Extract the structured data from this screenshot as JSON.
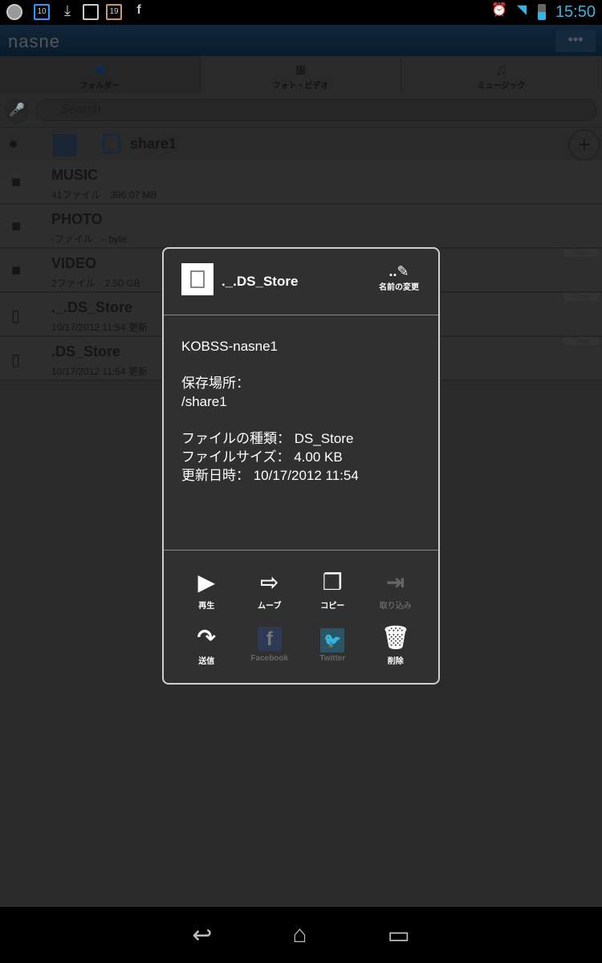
{
  "status_bar": {
    "time": "15:50",
    "notifications": [
      "nasne-icon",
      "calendar-10-icon",
      "download-icon",
      "image-icon",
      "calendar-19-icon",
      "facebook-icon"
    ],
    "calendar_a": "10",
    "calendar_b": "19"
  },
  "app": {
    "logo": "nasne",
    "overflow": "•••"
  },
  "tabs": [
    {
      "label": "フォルダー",
      "icon": "folder-icon",
      "active": true
    },
    {
      "label": "フォト・ビデオ",
      "icon": "camera-icon"
    },
    {
      "label": "ミュージック",
      "icon": "music-icon"
    }
  ],
  "search": {
    "placeholder": "Search"
  },
  "breadcrumb": {
    "current": "share1"
  },
  "list": [
    {
      "name": "MUSIC",
      "sub": "41ファイル　396.07 MB",
      "icon": "folder-icon"
    },
    {
      "name": "PHOTO",
      "sub": "-ファイル　- byte",
      "icon": "folder-icon"
    },
    {
      "name": "VIDEO",
      "sub": "2ファイル　2.50 GB",
      "icon": "folder-icon",
      "badge": "Today"
    },
    {
      "name": "._.DS_Store",
      "sub": "10/17/2012 11:54 更新",
      "icon": "file-icon",
      "badge": "Today"
    },
    {
      "name": ".DS_Store",
      "sub": "10/17/2012 11:54 更新",
      "icon": "file-icon",
      "badge": "Today"
    }
  ],
  "dialog": {
    "title": "._.DS_Store",
    "rename": "名前の変更",
    "device": "KOBSS-nasne1",
    "location_label": "保存場所：",
    "location": "/share1",
    "type_line": "ファイルの種類： DS_Store",
    "size_line": "ファイルサイズ： 4.00 KB",
    "date_line": "更新日時： 10/17/2012 11:54",
    "actions": [
      {
        "label": "再生",
        "icon": "play-icon",
        "enabled": true
      },
      {
        "label": "ムーブ",
        "icon": "move-icon",
        "enabled": true
      },
      {
        "label": "コピー",
        "icon": "copy-icon",
        "enabled": true
      },
      {
        "label": "取り込み",
        "icon": "import-icon",
        "enabled": false
      },
      {
        "label": "送信",
        "icon": "share-icon",
        "enabled": true
      },
      {
        "label": "Facebook",
        "icon": "facebook-icon",
        "enabled": false
      },
      {
        "label": "Twitter",
        "icon": "twitter-icon",
        "enabled": false
      },
      {
        "label": "削除",
        "icon": "trash-icon",
        "enabled": true
      }
    ]
  }
}
